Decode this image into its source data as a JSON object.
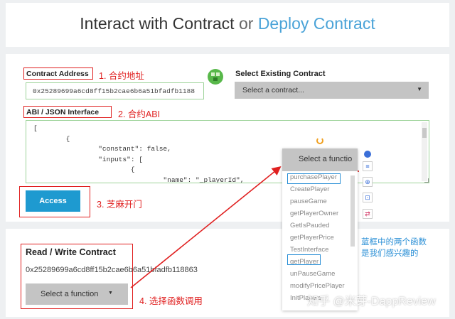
{
  "header": {
    "title": "Interact with Contract",
    "or": "or",
    "deploy": "Deploy Contract"
  },
  "contract": {
    "address_label": "Contract Address",
    "address_value": "0x25289699a6cd8ff15b2cae6b6a51bfadfb1188",
    "select_existing_label": "Select Existing Contract",
    "select_placeholder": "Select a contract...",
    "abi_label": "ABI / JSON Interface",
    "abi_lines": [
      "[",
      "        {",
      "                \"constant\": false,",
      "                \"inputs\": [",
      "                        {",
      "                                \"name\": \"_playerId\","
    ],
    "access_label": "Access"
  },
  "annotations": {
    "a1": "1. 合约地址",
    "a2": "2. 合约ABI",
    "a3": "3. 芝麻开门",
    "a4": "4. 选择函数调用",
    "blue_note_1": "蓝框中的两个函数",
    "blue_note_2": "是我们感兴趣的"
  },
  "rw": {
    "title": "Read / Write Contract",
    "address": "0x25289699a6cd8ff15b2cae6b6a51bfadfb118863",
    "select_function": "Select a function"
  },
  "dropdown": {
    "header": "Select a functio",
    "items": [
      "purchasePlayer",
      "CreatePlayer",
      "pauseGame",
      "getPlayerOwner",
      "GetIsPauded",
      "getPlayerPrice",
      "TestInterface",
      "getPlayer",
      "unPauseGame",
      "modifyPricePlayer",
      "InitPlayers"
    ]
  },
  "watermark": "知乎 @米芽-DappReview",
  "colors": {
    "accent_blue": "#1e9ad0",
    "annotation_red": "#e02020",
    "highlight_blue": "#2a8fd6"
  }
}
